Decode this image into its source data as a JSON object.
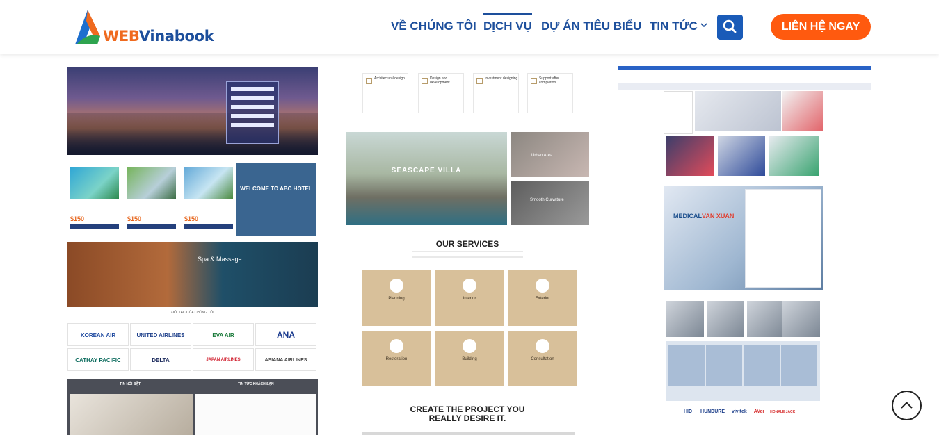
{
  "header": {
    "logo": {
      "prefix": "WEB",
      "suffix": "Vinabook"
    },
    "nav": [
      {
        "label": "VỀ CHÚNG TÔI",
        "active": false,
        "has_dropdown": false
      },
      {
        "label": "DỊCH VỤ",
        "active": true,
        "has_dropdown": false
      },
      {
        "label": "DỰ ÁN TIÊU BIỂU",
        "active": false,
        "has_dropdown": false
      },
      {
        "label": "TIN TỨC",
        "active": false,
        "has_dropdown": true
      }
    ],
    "search_icon": "search-icon",
    "cta_label": "LIÊN HỆ NGAY"
  },
  "colors": {
    "brand_blue": "#1d4f9c",
    "brand_orange": "#ff5a0f",
    "search_blue": "#1a5bb8"
  },
  "portfolio": {
    "hotel": {
      "welcome": "WELCOME TO ABC HOTEL",
      "rooms": [
        {
          "price": "$150"
        },
        {
          "price": "$150"
        },
        {
          "price": "$150"
        }
      ],
      "spa": "Spa & Massage",
      "partners_title": "ĐỐI TÁC CỦA CHÚNG TÔI",
      "airlines": [
        "KOREAN AIR",
        "UNITED AIRLINES",
        "EVA AIR",
        "ANA",
        "CATHAY PACIFIC",
        "DELTA",
        "JAPAN AIRLINES",
        "ASIANA AIRLINES"
      ],
      "news_left": "TIN NỔI BẬT",
      "news_right": "TIN TỨC KHÁCH SẠN"
    },
    "architecture": {
      "features": [
        "Architectural design",
        "Design and development",
        "Investment designing",
        "Support after completion"
      ],
      "villa": "SEASCAPE VILLA",
      "urban": "Urban Area",
      "curvature": "Smooth Curvature",
      "services_title": "OUR SERVICES",
      "services": [
        "Planning",
        "Interior",
        "Exterior",
        "Restoration",
        "Building",
        "Consultation"
      ],
      "create_line1": "CREATE THE PROJECT YOU",
      "create_line2": "REALLY DESIRE IT."
    },
    "medical": {
      "brand_a": "MEDICAL",
      "brand_b": "VAN XUAN",
      "brands": [
        "HID",
        "HUNDURE",
        "vivitek",
        "AVer",
        "HONALE JACK"
      ]
    }
  },
  "gotop_icon": "chevron-up-icon"
}
